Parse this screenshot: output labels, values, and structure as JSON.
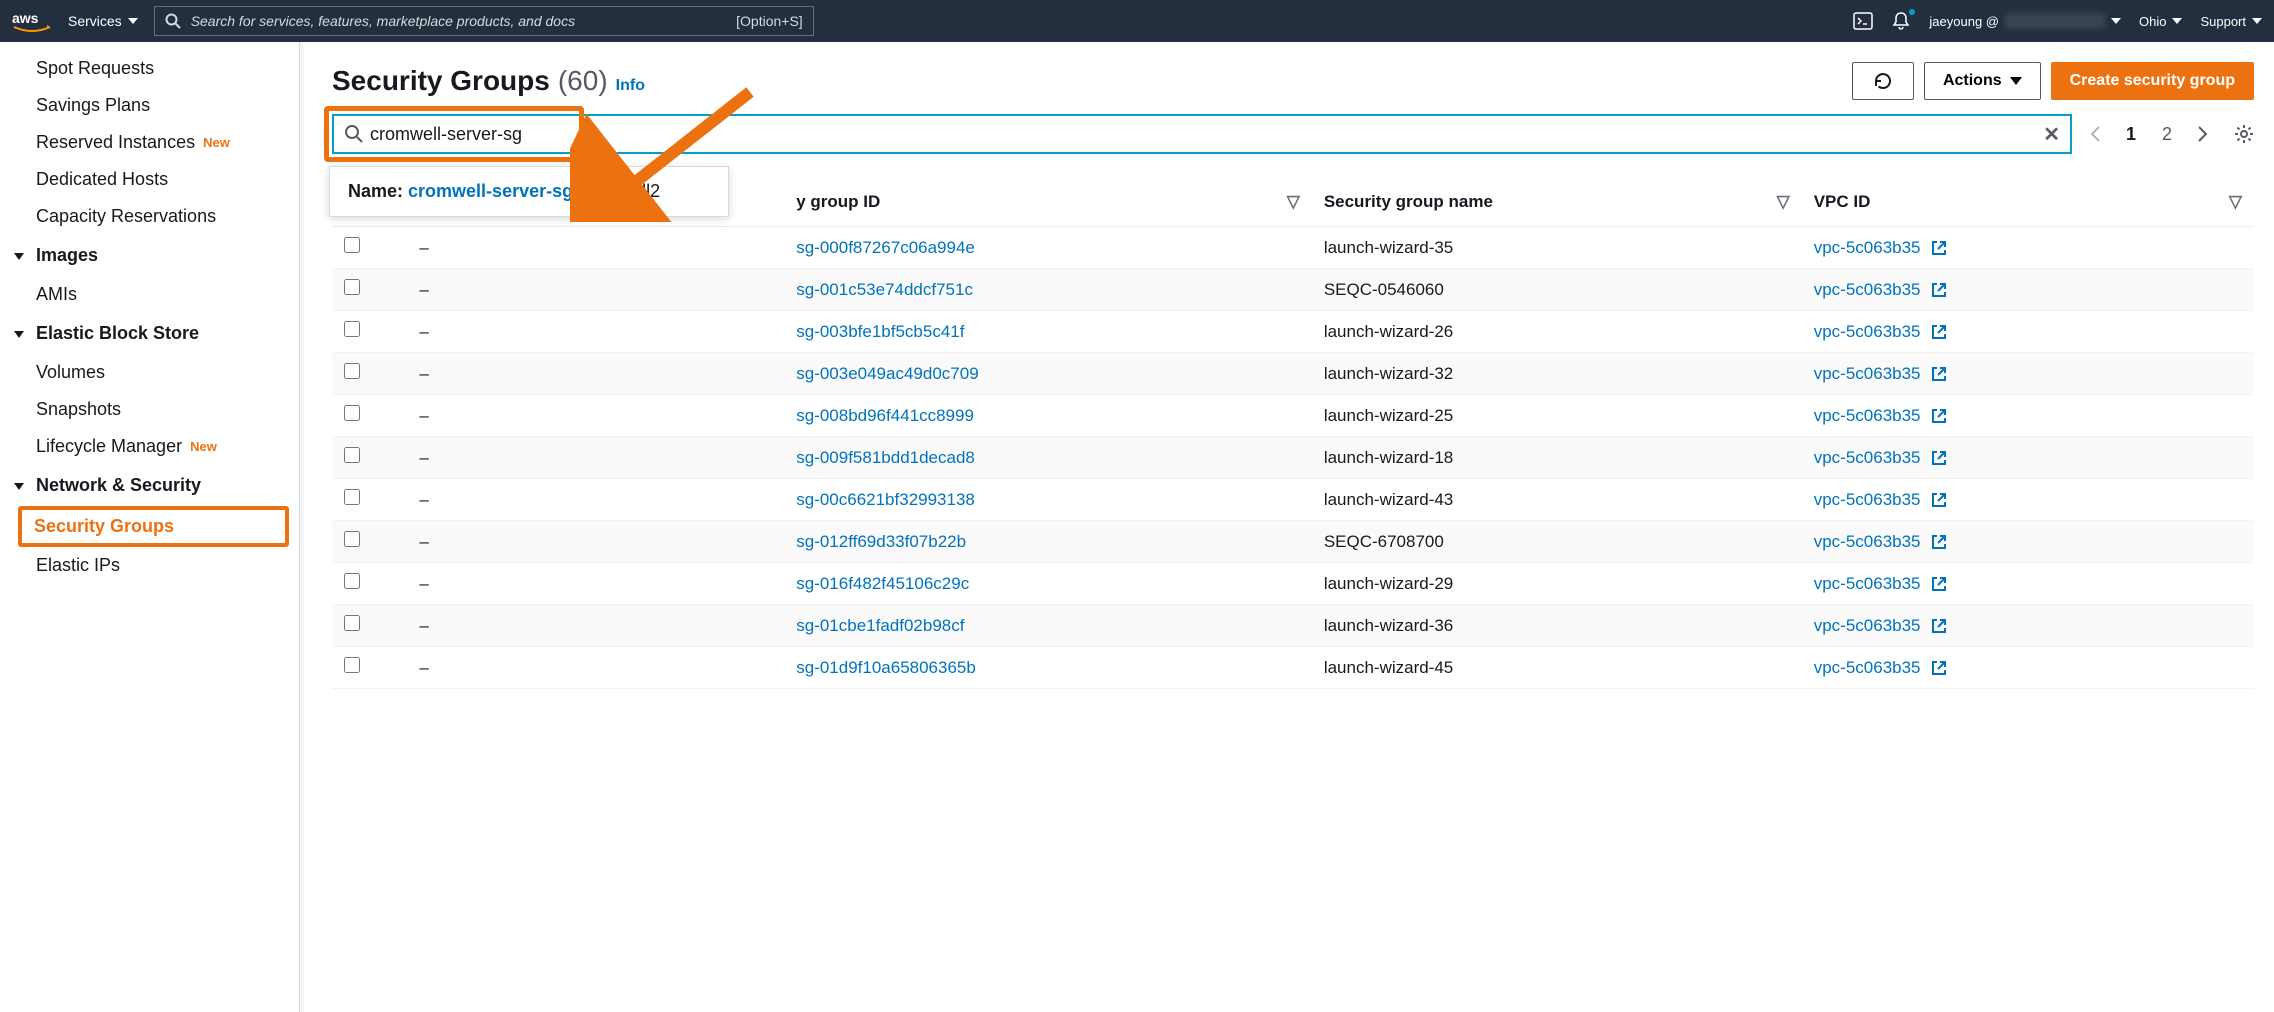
{
  "nav": {
    "services_label": "Services",
    "search_placeholder": "Search for services, features, marketplace products, and docs",
    "search_kbd": "[Option+S]",
    "account_label": "jaeyoung @",
    "region_label": "Ohio",
    "support_label": "Support"
  },
  "sidebar": {
    "items_top": [
      {
        "label": "Spot Requests"
      },
      {
        "label": "Savings Plans"
      },
      {
        "label": "Reserved Instances",
        "new": true
      },
      {
        "label": "Dedicated Hosts"
      },
      {
        "label": "Capacity Reservations"
      }
    ],
    "section_images": "Images",
    "images_items": [
      {
        "label": "AMIs"
      }
    ],
    "section_ebs": "Elastic Block Store",
    "ebs_items": [
      {
        "label": "Volumes"
      },
      {
        "label": "Snapshots"
      },
      {
        "label": "Lifecycle Manager",
        "new": true
      }
    ],
    "section_net": "Network & Security",
    "net_items": [
      {
        "label": "Security Groups",
        "selected": true
      },
      {
        "label": "Elastic IPs"
      }
    ],
    "new_badge": "New"
  },
  "header": {
    "title": "Security Groups",
    "count": "(60)",
    "info": "Info",
    "actions_label": "Actions",
    "create_label": "Create security group"
  },
  "filter": {
    "value": "cromwell-server-sg",
    "autocomplete_label": "Name: ",
    "autocomplete_match": "cromwell-server-sg",
    "autocomplete_rest": "-cromwell2"
  },
  "pager": {
    "page1": "1",
    "page2": "2"
  },
  "table": {
    "headers": {
      "name_partial": "",
      "sgid": "y group ID",
      "sgname": "Security group name",
      "vpc": "VPC ID"
    },
    "rows": [
      {
        "name": "–",
        "sgid": "sg-000f87267c06a994e",
        "sgname": "launch-wizard-35",
        "vpc": "vpc-5c063b35"
      },
      {
        "name": "–",
        "sgid": "sg-001c53e74ddcf751c",
        "sgname": "SEQC-0546060",
        "vpc": "vpc-5c063b35"
      },
      {
        "name": "–",
        "sgid": "sg-003bfe1bf5cb5c41f",
        "sgname": "launch-wizard-26",
        "vpc": "vpc-5c063b35"
      },
      {
        "name": "–",
        "sgid": "sg-003e049ac49d0c709",
        "sgname": "launch-wizard-32",
        "vpc": "vpc-5c063b35"
      },
      {
        "name": "–",
        "sgid": "sg-008bd96f441cc8999",
        "sgname": "launch-wizard-25",
        "vpc": "vpc-5c063b35"
      },
      {
        "name": "–",
        "sgid": "sg-009f581bdd1decad8",
        "sgname": "launch-wizard-18",
        "vpc": "vpc-5c063b35"
      },
      {
        "name": "–",
        "sgid": "sg-00c6621bf32993138",
        "sgname": "launch-wizard-43",
        "vpc": "vpc-5c063b35"
      },
      {
        "name": "–",
        "sgid": "sg-012ff69d33f07b22b",
        "sgname": "SEQC-6708700",
        "vpc": "vpc-5c063b35"
      },
      {
        "name": "–",
        "sgid": "sg-016f482f45106c29c",
        "sgname": "launch-wizard-29",
        "vpc": "vpc-5c063b35"
      },
      {
        "name": "–",
        "sgid": "sg-01cbe1fadf02b98cf",
        "sgname": "launch-wizard-36",
        "vpc": "vpc-5c063b35"
      },
      {
        "name": "–",
        "sgid": "sg-01d9f10a65806365b",
        "sgname": "launch-wizard-45",
        "vpc": "vpc-5c063b35"
      }
    ]
  }
}
